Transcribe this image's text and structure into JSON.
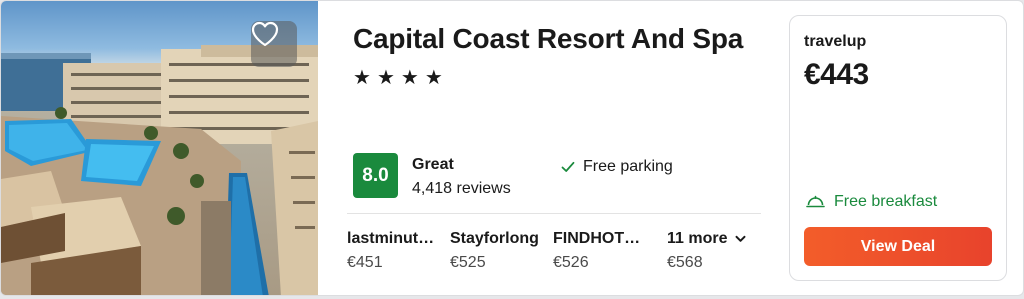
{
  "hotel": {
    "name": "Capital Coast Resort And Spa",
    "stars": [
      "★",
      "★",
      "★",
      "★"
    ]
  },
  "rating": {
    "score": "8.0",
    "label": "Great",
    "reviews": "4,418 reviews"
  },
  "amenity": {
    "label": "Free parking",
    "icon": "check-icon"
  },
  "offers": [
    {
      "provider": "lastminut…",
      "price": "€451"
    },
    {
      "provider": "Stayforlong",
      "price": "€525"
    },
    {
      "provider": "FINDHOT…",
      "price": "€526"
    }
  ],
  "more_offers": {
    "label": "11 more",
    "price": "€568"
  },
  "deal": {
    "provider": "travelup",
    "price": "€443",
    "extra": "Free breakfast",
    "button_label": "View Deal"
  },
  "colors": {
    "rating_badge": "#1a8a3d",
    "deal_button": "#ef4f2b",
    "breakfast_text": "#1a8a3d"
  }
}
